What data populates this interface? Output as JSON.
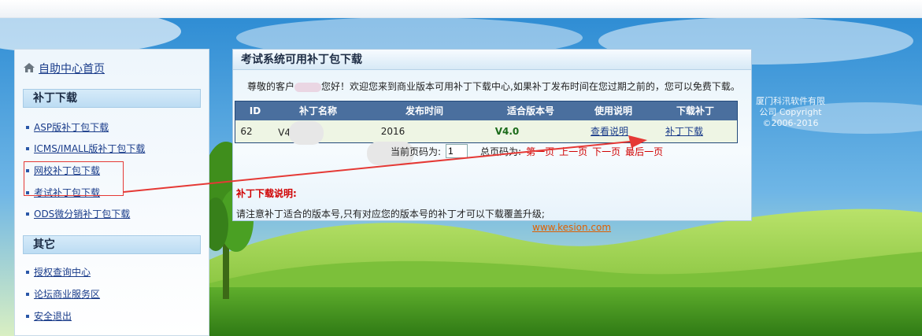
{
  "sidebar": {
    "home_label": "自助中心首页",
    "section_patch": "补丁下载",
    "patch_items": [
      {
        "label": "ASP版补丁包下载"
      },
      {
        "label": "ICMS/IMALL版补丁包下载"
      },
      {
        "label": "网校补丁包下载"
      },
      {
        "label": "考试补丁包下载"
      },
      {
        "label": "ODS微分销补丁包下载"
      }
    ],
    "section_other": "其它",
    "other_items": [
      {
        "label": "授权查询中心"
      },
      {
        "label": "论坛商业服务区"
      },
      {
        "label": "安全退出"
      }
    ]
  },
  "panel": {
    "title": "考试系统可用补丁包下载",
    "welcome_prefix": "尊敬的客户",
    "welcome_suffix": "您好！欢迎您来到商业版本可用补丁下载中心,如果补丁发布时间在您过期之前的，您可以免费下载。",
    "headers": [
      "ID",
      "补丁名称",
      "发布时间",
      "适合版本号",
      "使用说明",
      "下载补丁"
    ],
    "row": {
      "id": "62",
      "name": "V4.",
      "date": "2016",
      "version": "V4.0",
      "usage_link": "查看说明",
      "download_link": "补丁下载"
    },
    "pager": {
      "label": "当前页码为:",
      "value": "1",
      "total": "总页码为:",
      "first": "第一页",
      "prev": "上一页",
      "next": "下一页",
      "last": "最后一页"
    },
    "note_title": "补丁下载说明:",
    "note_text": "请注意补丁适合的版本号,只有对应您的版本号的补丁才可以下载覆盖升级;"
  },
  "url": "www.kesion.com",
  "copyright": {
    "line1": "厦门科汛软件有限",
    "line2": "公司 Copyright",
    "line3": "©2006-2016"
  },
  "colors": {
    "sky_top": "#2f8dd4",
    "grass": "#4f9b2a",
    "accent_red": "#e53935",
    "table_header": "#4a6f9e"
  }
}
